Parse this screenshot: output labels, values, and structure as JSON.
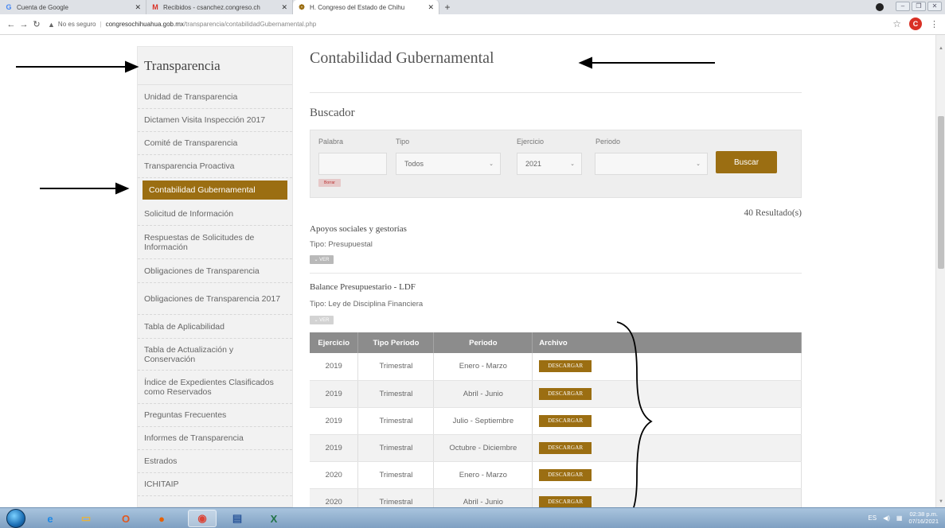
{
  "browser": {
    "tabs": [
      {
        "icon": "google-g-icon",
        "glyph": "G",
        "color": "#4285f4",
        "title": "Cuenta de Google",
        "active": false
      },
      {
        "icon": "gmail-icon",
        "glyph": "M",
        "color": "#d93025",
        "title": "Recibidos - csanchez.congreso.ch",
        "active": false
      },
      {
        "icon": "congress-favicon-icon",
        "glyph": "❁",
        "color": "#9b6e12",
        "title": "H. Congreso del Estado de Chihu",
        "active": true
      }
    ],
    "new_tab": "+",
    "security": "No es seguro",
    "url_domain": "congresochihuahua.gob.mx",
    "url_path": "/transparencia/contabilidadGubernamental.php",
    "profile_initial": "C"
  },
  "sidebar": {
    "title": "Transparencia",
    "items": [
      {
        "label": "Unidad de Transparencia",
        "active": false,
        "h": 30
      },
      {
        "label": "Dictamen Visita Inspección 2017",
        "active": false,
        "h": 29
      },
      {
        "label": "Comité de Transparencia",
        "active": false,
        "h": 29
      },
      {
        "label": "Transparencia Proactiva",
        "active": false,
        "h": 29
      },
      {
        "label": "Contabilidad Gubernamental",
        "active": true,
        "h": 24
      },
      {
        "label": "Solicitud de Información",
        "active": false,
        "h": 30
      },
      {
        "label": "Respuestas de Solicitudes de Información",
        "active": false,
        "h": 42
      },
      {
        "label": "Obligaciones de Transparencia",
        "active": false,
        "h": 30
      },
      {
        "label": "Obligaciones de Transparencia 2017",
        "active": false,
        "h": 40
      },
      {
        "label": "Tabla de Aplicabilidad",
        "active": false,
        "h": 30
      },
      {
        "label": "Tabla de Actualización y Conservación",
        "active": false,
        "h": 40
      },
      {
        "label": "Índice de Expedientes Clasificados como Reservados",
        "active": false,
        "h": 42
      },
      {
        "label": "Preguntas Frecuentes",
        "active": false,
        "h": 29
      },
      {
        "label": "Informes de Transparencia",
        "active": false,
        "h": 29
      },
      {
        "label": "Estrados",
        "active": false,
        "h": 29
      },
      {
        "label": "ICHITAIP",
        "active": false,
        "h": 29
      }
    ]
  },
  "main": {
    "title": "Contabilidad Gubernamental",
    "search_title": "Buscador",
    "search": {
      "palabra_label": "Palabra",
      "palabra_value": "",
      "tipo_label": "Tipo",
      "tipo_value": "Todos",
      "ejercicio_label": "Ejercicio",
      "ejercicio_value": "2021",
      "periodo_label": "Periodo",
      "periodo_value": "",
      "search_button": "Buscar",
      "clear_button": "Borrar"
    },
    "results_count": "40 Resultado(s)",
    "items": [
      {
        "title": "Apoyos sociales y gestorías",
        "type": "Tipo: Presupuestal",
        "ver": "VER"
      },
      {
        "title": "Balance Presupuestario - LDF",
        "type": "Tipo: Ley de Disciplina Financiera",
        "ver": "VER"
      }
    ],
    "table": {
      "headers": [
        "Ejercicio",
        "Tipo Periodo",
        "Periodo",
        "Archivo"
      ],
      "download_label": "DESCARGAR",
      "rows": [
        [
          "2019",
          "Trimestral",
          "Enero - Marzo"
        ],
        [
          "2019",
          "Trimestral",
          "Abril - Junio"
        ],
        [
          "2019",
          "Trimestral",
          "Julio - Septiembre"
        ],
        [
          "2019",
          "Trimestral",
          "Octubre - Diciembre"
        ],
        [
          "2020",
          "Trimestral",
          "Enero - Marzo"
        ],
        [
          "2020",
          "Trimestral",
          "Abril - Junio"
        ]
      ]
    }
  },
  "taskbar": {
    "apps": [
      {
        "name": "ie-icon",
        "glyph": "e",
        "color": "#1e88e5",
        "active": false
      },
      {
        "name": "explorer-folder-icon",
        "glyph": "▭",
        "color": "#e8b33a",
        "active": false
      },
      {
        "name": "office-icon",
        "glyph": "O",
        "color": "#e2571e",
        "active": false
      },
      {
        "name": "firefox-icon",
        "glyph": "●",
        "color": "#e66000",
        "active": false
      },
      {
        "name": "chrome-icon",
        "glyph": "◉",
        "color": "#db4437",
        "active": true
      },
      {
        "name": "document-viewer-icon",
        "glyph": "▤",
        "color": "#2b579a",
        "active": false
      },
      {
        "name": "excel-icon",
        "glyph": "X",
        "color": "#217346",
        "active": false
      }
    ],
    "lang": "ES",
    "time": "02:38 p.m.",
    "date": "07/16/2021"
  }
}
